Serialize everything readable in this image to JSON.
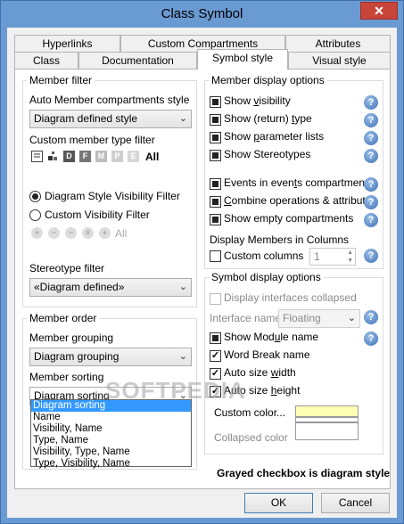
{
  "window": {
    "title": "Class Symbol",
    "close_glyph": "✕"
  },
  "tabs_row1": [
    "Hyperlinks",
    "Custom Compartments",
    "Attributes"
  ],
  "tabs_row2": [
    "Class",
    "Documentation",
    "Symbol style",
    "Visual style"
  ],
  "active_tab": "Symbol style",
  "member_filter": {
    "title": "Member filter",
    "auto_label": "Auto Member compartments style",
    "auto_value": "Diagram defined style",
    "custom_type_label": "Custom member type filter",
    "type_icons": [
      "class-attr-icon",
      "operation-icon",
      "default-icon",
      "filter-f-icon",
      "filter-m-icon",
      "filter-p-icon",
      "filter-e-icon"
    ],
    "type_icon_letters": [
      "",
      "",
      "D",
      "F",
      "M",
      "P",
      "E"
    ],
    "type_all": "All",
    "radio_diagram": "Diagram Style Visibility Filter",
    "radio_custom": "Custom Visibility Filter",
    "vis_icons": [
      "public-icon",
      "private-icon",
      "protected-icon",
      "package-icon",
      "derived-icon"
    ],
    "vis_all": "All",
    "stereo_label": "Stereotype filter",
    "stereo_value": "«Diagram defined»"
  },
  "member_order": {
    "title": "Member order",
    "grouping_label": "Member grouping",
    "grouping_value": "Diagram grouping",
    "sorting_label": "Member sorting",
    "sorting_value": "Diagram sorting",
    "sorting_options": [
      "Diagram sorting",
      "Name",
      "Visibility, Name",
      "Type, Name",
      "Visibility, Type, Name",
      "Type, Visibility, Name"
    ]
  },
  "member_display": {
    "title": "Member display options",
    "items": [
      {
        "pre": "Show ",
        "key": "v",
        "post": "isibility"
      },
      {
        "pre": "Show (return) ",
        "key": "t",
        "post": "ype"
      },
      {
        "pre": "Show ",
        "key": "p",
        "post": "arameter lists"
      },
      {
        "pre": "Show Stereotypes",
        "key": "",
        "post": ""
      },
      {
        "pre": "Events in even",
        "key": "t",
        "post": "s compartment"
      },
      {
        "pre": "",
        "key": "C",
        "post": "ombine operations & attributes"
      },
      {
        "pre": "Show empty compartments",
        "key": "",
        "post": ""
      }
    ],
    "columns_label": "Display Members in Columns",
    "custom_columns": "Custom columns",
    "columns_value": "1"
  },
  "symbol_display": {
    "title": "Symbol display options",
    "interfaces_collapsed": "Display interfaces collapsed",
    "interface_name_label": "Interface name",
    "interface_name_value": "Floating",
    "show_module": {
      "pre": "Show Mod",
      "key": "u",
      "post": "le name"
    },
    "word_break": "Word Break name",
    "auto_width": {
      "pre": "Auto size ",
      "key": "w",
      "post": "idth"
    },
    "auto_height": {
      "pre": "Auto size ",
      "key": "h",
      "post": "eight"
    },
    "custom_color": "Custom color...",
    "collapsed_color": "Collapsed color",
    "custom_color_hex": "#ffffb4"
  },
  "footer_note": "Grayed checkbox is diagram style",
  "buttons": {
    "ok": "OK",
    "cancel": "Cancel"
  },
  "watermark": "SOFTPEDIA"
}
